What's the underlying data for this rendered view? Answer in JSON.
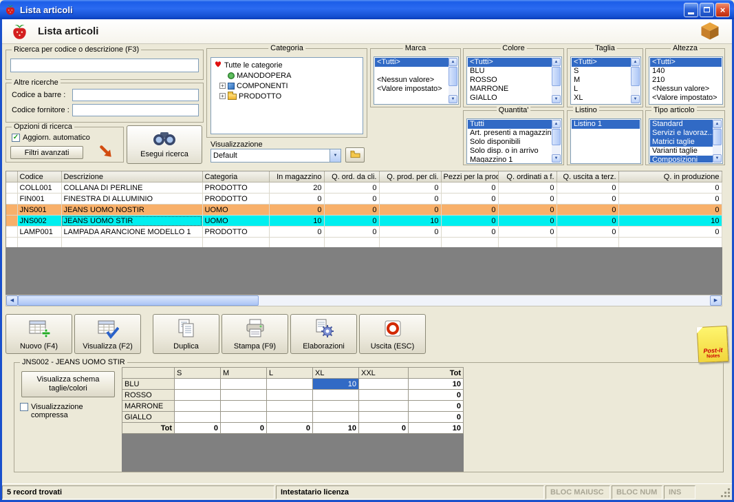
{
  "colors": {
    "selection_blue": "#316AC5",
    "row_orange": "#F8B06A",
    "row_cyan": "#00EFEF",
    "titlebar_blue": "#1450D2"
  },
  "titlebar": {
    "title": "Lista articoli"
  },
  "header": {
    "title": "Lista articoli"
  },
  "filters": {
    "search_group_label": "Ricerca per codice o descrizione (F3)",
    "search_value": "",
    "altre_ricerche_label": "Altre ricerche",
    "codice_barre_label": "Codice a barre :",
    "codice_barre_value": "",
    "codice_fornitore_label": "Codice fornitore :",
    "codice_fornitore_value": "",
    "opzioni_label": "Opzioni di ricerca",
    "aggiorn_automatico_label": "Aggiorn. automatico",
    "filtri_avanzati_label": "Filtri avanzati",
    "esegui_ricerca_label": "Esegui ricerca",
    "categoria": {
      "title": "Categoria",
      "root": "Tutte le categorie",
      "nodes": [
        {
          "label": "MANODOPERA",
          "icon": "gear",
          "expand": false
        },
        {
          "label": "COMPONENTI",
          "icon": "components",
          "expand": true
        },
        {
          "label": "PRODOTTO",
          "icon": "folder",
          "expand": true
        }
      ]
    },
    "visualizzazione_label": "Visualizzazione",
    "visualizzazione_value": "Default",
    "marca": {
      "title": "Marca",
      "items": [
        {
          "label": "<Tutti>",
          "sel": true
        },
        {
          "label": "",
          "sel": false
        },
        {
          "label": "<Nessun valore>",
          "sel": false
        },
        {
          "label": "<Valore impostato>",
          "sel": false
        }
      ]
    },
    "colore": {
      "title": "Colore",
      "items": [
        {
          "label": "<Tutti>",
          "sel": true
        },
        {
          "label": "BLU",
          "sel": false
        },
        {
          "label": "ROSSO",
          "sel": false
        },
        {
          "label": "MARRONE",
          "sel": false
        },
        {
          "label": "GIALLO",
          "sel": false
        }
      ]
    },
    "taglia": {
      "title": "Taglia",
      "items": [
        {
          "label": "<Tutti>",
          "sel": true
        },
        {
          "label": "S",
          "sel": false
        },
        {
          "label": "M",
          "sel": false
        },
        {
          "label": "L",
          "sel": false
        },
        {
          "label": "XL",
          "sel": false
        }
      ]
    },
    "altezza": {
      "title": "Altezza",
      "items": [
        {
          "label": "<Tutti>",
          "sel": true
        },
        {
          "label": "140",
          "sel": false
        },
        {
          "label": "210",
          "sel": false
        },
        {
          "label": "<Nessun valore>",
          "sel": false
        },
        {
          "label": "<Valore impostato>",
          "sel": false
        }
      ]
    },
    "quantita": {
      "title": "Quantita'",
      "items": [
        {
          "label": "Tutti",
          "sel": true
        },
        {
          "label": "Art. presenti a magazzino",
          "sel": false
        },
        {
          "label": "Solo disponibili",
          "sel": false
        },
        {
          "label": "Solo disp. o in arrivo",
          "sel": false
        },
        {
          "label": "Magazzino 1",
          "sel": false
        }
      ]
    },
    "listino": {
      "title": "Listino",
      "items": [
        {
          "label": "Listino 1",
          "sel": true
        }
      ]
    },
    "tipo_articolo": {
      "title": "Tipo articolo",
      "items": [
        {
          "label": "Standard",
          "sel": true
        },
        {
          "label": "Servizi e lavoraz...",
          "sel": true
        },
        {
          "label": "Matrici taglie",
          "sel": true
        },
        {
          "label": "Varianti taglie",
          "sel": false
        },
        {
          "label": "Composizioni",
          "sel": true
        }
      ]
    }
  },
  "grid": {
    "columns": [
      "Codice",
      "Descrizione",
      "Categoria",
      "In magazzino",
      "Q. ord. da cli.",
      "Q. prod. per cli.",
      "Pezzi per la prod.",
      "Q. ordinati a f.",
      "Q. uscita a terz.",
      "Q. in produzione"
    ],
    "rows": [
      {
        "cls": "",
        "cells": [
          "COLL001",
          "COLLANA DI PERLINE",
          "PRODOTTO",
          "20",
          "0",
          "0",
          "0",
          "0",
          "0",
          "0"
        ]
      },
      {
        "cls": "",
        "cells": [
          "FIN001",
          "FINESTRA DI ALLUMINIO",
          "PRODOTTO",
          "0",
          "0",
          "0",
          "0",
          "0",
          "0",
          "0"
        ]
      },
      {
        "cls": "orange",
        "cells": [
          "JNS001",
          "JEANS UOMO NOSTIR",
          "UOMO",
          "0",
          "0",
          "0",
          "0",
          "0",
          "0",
          "0"
        ]
      },
      {
        "cls": "cyan",
        "cells": [
          "JNS002",
          "JEANS UOMO STIR",
          "UOMO",
          "10",
          "0",
          "10",
          "0",
          "0",
          "0",
          "10"
        ]
      },
      {
        "cls": "",
        "cells": [
          "LAMP001",
          "LAMPADA ARANCIONE MODELLO 1",
          "PRODOTTO",
          "0",
          "0",
          "0",
          "0",
          "0",
          "0",
          "0"
        ]
      }
    ]
  },
  "toolbar": {
    "buttons": [
      "Nuovo (F4)",
      "Visualizza (F2)",
      "Duplica",
      "Stampa (F9)",
      "Elaborazioni",
      "Uscita (ESC)"
    ],
    "postit_line1": "Post-it",
    "postit_line2": "Notes"
  },
  "detail": {
    "title": "JNS002 - JEANS UOMO STIR",
    "schema_button": "Visualizza schema taglie/colori",
    "compressa_label": "Visualizzazione compressa",
    "matrix": {
      "columns": [
        "S",
        "M",
        "L",
        "XL",
        "XXL",
        "Tot"
      ],
      "rows": [
        {
          "cls": "",
          "label": "BLU",
          "values": [
            "",
            "",
            "",
            "10",
            "",
            "10"
          ]
        },
        {
          "cls": "",
          "label": "ROSSO",
          "values": [
            "",
            "",
            "",
            "",
            "",
            "0"
          ]
        },
        {
          "cls": "",
          "label": "MARRONE",
          "values": [
            "",
            "",
            "",
            "",
            "",
            "0"
          ]
        },
        {
          "cls": "",
          "label": "GIALLO",
          "values": [
            "",
            "",
            "",
            "",
            "",
            "0"
          ]
        },
        {
          "cls": "totrow",
          "label": "Tot",
          "values": [
            "0",
            "0",
            "0",
            "10",
            "0",
            "10"
          ]
        }
      ],
      "selected_cell": {
        "row": 0,
        "col": 3
      }
    }
  },
  "statusbar": {
    "records": "5 record trovati",
    "license": "Intestatario licenza",
    "caps": "BLOC MAIUSC",
    "num": "BLOC NUM",
    "ins": "INS"
  }
}
